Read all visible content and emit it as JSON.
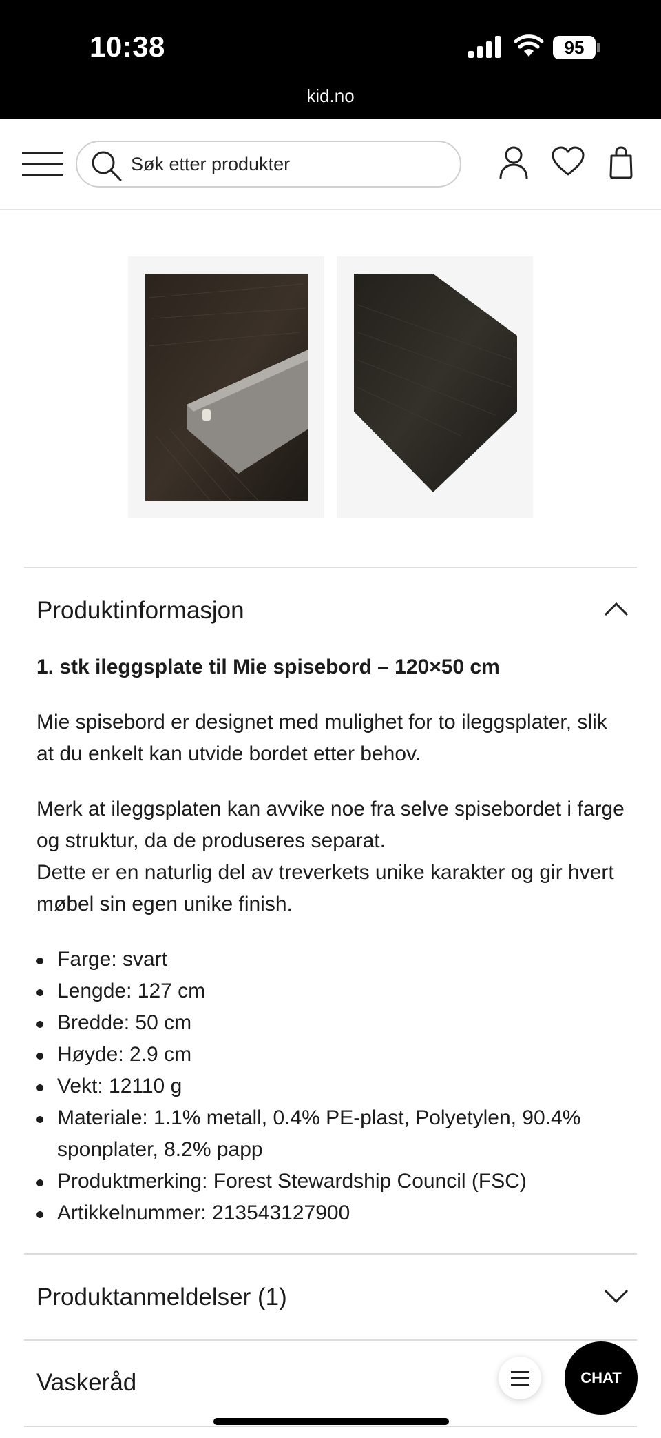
{
  "status_bar": {
    "time": "10:38",
    "battery": "95",
    "url": "kid.no"
  },
  "header": {
    "menu_icon": "hamburger-menu-icon",
    "search_placeholder": "Søk etter produkter",
    "search_icon": "search-icon",
    "account_icon": "user-icon",
    "wishlist_icon": "heart-icon",
    "cart_icon": "shopping-bag-icon"
  },
  "gallery": {
    "images": [
      "product-image-corner-detail",
      "product-image-full-board"
    ]
  },
  "product_info": {
    "title": "Produktinformasjon",
    "expanded": true,
    "heading": "1. stk ileggsplate til Mie spisebord – 120×50 cm",
    "paragraph1": "Mie spisebord er designet med mulighet for to ileggsplater, slik at du enkelt kan utvide bordet etter behov.",
    "paragraph2a": "Merk at ileggsplaten kan avvike noe fra selve spisebordet i farge og struktur, da de produseres separat.",
    "paragraph2b": "Dette er en naturlig del av treverkets unike karakter og gir hvert møbel sin egen unike finish.",
    "specs": [
      "Farge: svart",
      "Lengde: 127 cm",
      "Bredde: 50 cm",
      "Høyde: 2.9 cm",
      "Vekt: 12110 g",
      "Materiale: 1.1% metall, 0.4% PE-plast, Polyetylen, 90.4% sponplater, 8.2% papp",
      "Produktmerking: Forest Stewardship Council (FSC)",
      "Artikkelnummer: 213543127900"
    ]
  },
  "reviews": {
    "title": "Produktanmeldelser (1)",
    "expanded": false
  },
  "care": {
    "title": "Vaskeråd"
  },
  "floating": {
    "chat_label": "CHAT"
  }
}
